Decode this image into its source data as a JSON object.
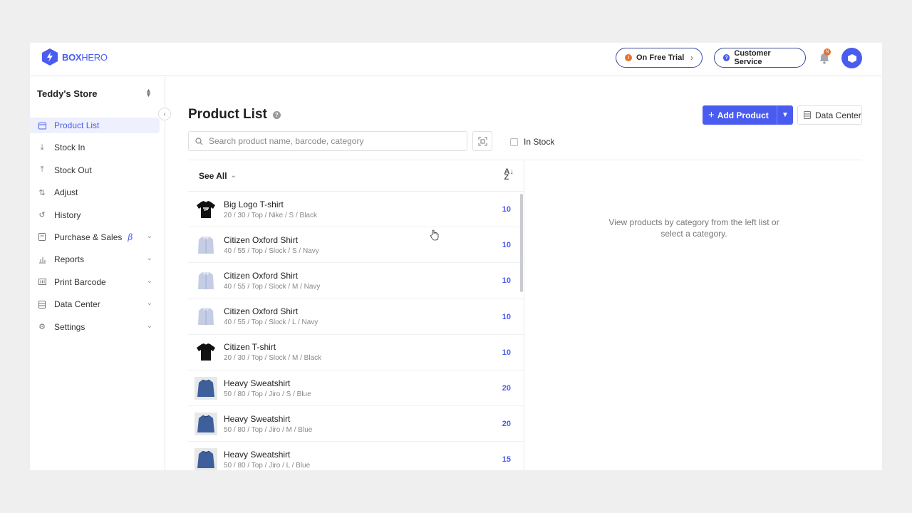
{
  "brand": {
    "name_bold": "BOX",
    "name_light": "HERO"
  },
  "header": {
    "trial_label": "On Free Trial",
    "cs_label": "Customer Service",
    "notification_badge": "N"
  },
  "sidebar": {
    "store_name": "Teddy's Store",
    "items": [
      {
        "label": "Product List",
        "icon": "box-icon",
        "active": true
      },
      {
        "label": "Stock In",
        "icon": "arrow-down-icon"
      },
      {
        "label": "Stock Out",
        "icon": "arrow-up-icon"
      },
      {
        "label": "Adjust",
        "icon": "swap-icon"
      },
      {
        "label": "History",
        "icon": "history-icon"
      },
      {
        "label": "Purchase & Sales",
        "icon": "document-icon",
        "badge": "β",
        "expandable": true
      },
      {
        "label": "Reports",
        "icon": "bar-chart-icon",
        "expandable": true
      },
      {
        "label": "Print Barcode",
        "icon": "barcode-icon",
        "expandable": true
      },
      {
        "label": "Data Center",
        "icon": "database-icon",
        "expandable": true
      },
      {
        "label": "Settings",
        "icon": "gear-icon",
        "expandable": true
      }
    ]
  },
  "main": {
    "title": "Product List",
    "add_button": "Add Product",
    "data_center_button": "Data Center",
    "search_placeholder": "Search product name, barcode, category",
    "in_stock_label": "In Stock",
    "filter_label": "See All",
    "empty_message_line1": "View products by category from the left list or",
    "empty_message_line2": "select a category.",
    "products": [
      {
        "name": "Big Logo T-shirt",
        "attrs": "20 / 30 / Top / Nike / S / Black",
        "qty": "10",
        "thumb": "black-tshirt"
      },
      {
        "name": "Citizen Oxford Shirt",
        "attrs": "40 / 55 / Top / Slock / S / Navy",
        "qty": "10",
        "thumb": "oxford-shirt"
      },
      {
        "name": "Citizen Oxford Shirt",
        "attrs": "40 / 55 / Top / Slock / M / Navy",
        "qty": "10",
        "thumb": "oxford-shirt"
      },
      {
        "name": "Citizen Oxford Shirt",
        "attrs": "40 / 55 / Top / Slock / L / Navy",
        "qty": "10",
        "thumb": "oxford-shirt"
      },
      {
        "name": "Citizen T-shirt",
        "attrs": "20 / 30 / Top / Slock / M / Black",
        "qty": "10",
        "thumb": "black-tshirt-plain"
      },
      {
        "name": "Heavy Sweatshirt",
        "attrs": "50 / 80 / Top / Jiro / S / Blue",
        "qty": "20",
        "thumb": "sweatshirt"
      },
      {
        "name": "Heavy Sweatshirt",
        "attrs": "50 / 80 / Top / Jiro / M / Blue",
        "qty": "20",
        "thumb": "sweatshirt"
      },
      {
        "name": "Heavy Sweatshirt",
        "attrs": "50 / 80 / Top / Jiro / L / Blue",
        "qty": "15",
        "thumb": "sweatshirt"
      }
    ]
  },
  "colors": {
    "accent": "#4a5cf0",
    "trial_dot": "#e8702a"
  }
}
